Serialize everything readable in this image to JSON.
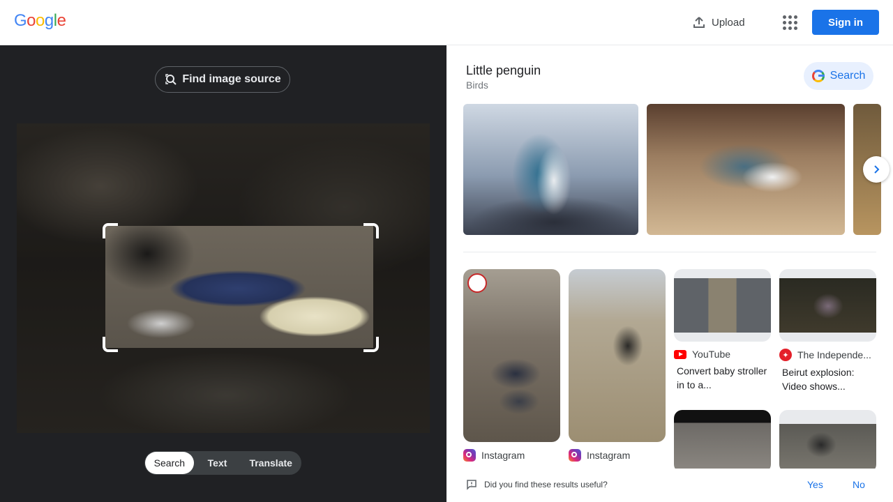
{
  "header": {
    "logo_letters": [
      {
        "ch": "G",
        "color": "#4285f4"
      },
      {
        "ch": "o",
        "color": "#ea4335"
      },
      {
        "ch": "o",
        "color": "#fbbc05"
      },
      {
        "ch": "g",
        "color": "#4285f4"
      },
      {
        "ch": "l",
        "color": "#34a853"
      },
      {
        "ch": "e",
        "color": "#ea4335"
      }
    ],
    "upload_label": "Upload",
    "signin_label": "Sign in"
  },
  "left": {
    "find_source_label": "Find image source",
    "tabs": [
      "Search",
      "Text",
      "Translate"
    ],
    "active_tab": "Search"
  },
  "right": {
    "entity_title": "Little penguin",
    "entity_subtitle": "Birds",
    "search_label": "Search",
    "results": [
      {
        "source": "Instagram",
        "icon": "instagram-icon",
        "title": ""
      },
      {
        "source": "Instagram",
        "icon": "instagram-icon",
        "title": ""
      },
      {
        "source": "YouTube",
        "icon": "youtube-icon",
        "title": "Convert baby stroller in to a..."
      },
      {
        "source": "The Independe...",
        "icon": "independent-icon",
        "title": "Beirut explosion: Video shows..."
      }
    ],
    "feedback": {
      "question": "Did you find these results useful?",
      "yes": "Yes",
      "no": "No"
    }
  },
  "colors": {
    "accent": "#1a73e8",
    "dark_panel": "#202124"
  }
}
